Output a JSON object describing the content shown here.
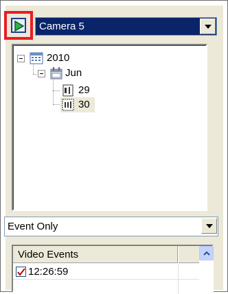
{
  "camera_select": {
    "value": "Camera 5"
  },
  "tree": {
    "year": "2010",
    "month": "Jun",
    "days": [
      "29",
      "30"
    ],
    "selected_day": "30"
  },
  "event_filter": {
    "value": "Event Only"
  },
  "events_list": {
    "header": "Video Events",
    "rows": [
      {
        "time": "12:26:59",
        "checked": true
      }
    ]
  },
  "colors": {
    "highlight_border": "#ec1b24",
    "selected_bg": "#0a246a",
    "panel_bg": "#ece9d8",
    "checkmark": "#c40000"
  },
  "icons": {
    "play": "play-icon",
    "dropdown": "chevron-down-icon",
    "calendar_year": "calendar-icon",
    "calendar_month": "calendar-month-icon",
    "day": "day-icon",
    "scroll_up": "chevron-up-icon",
    "check": "check-icon"
  }
}
